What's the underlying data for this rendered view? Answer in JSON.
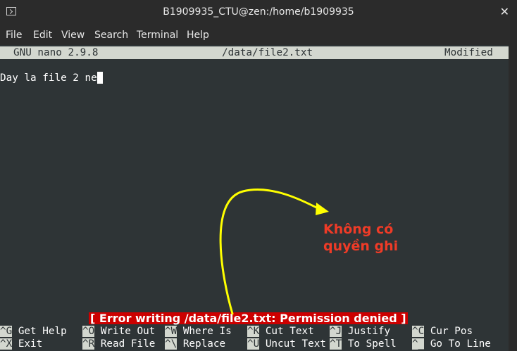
{
  "window": {
    "title": "B1909935_CTU@zen:/home/b1909935",
    "close_glyph": "✕"
  },
  "menu": [
    "File",
    "Edit",
    "View",
    "Search",
    "Terminal",
    "Help"
  ],
  "nano": {
    "version": "GNU nano 2.9.8",
    "filename": "/data/file2.txt",
    "state": "Modified",
    "content": "Day la file 2 ne",
    "status_message": "[ Error writing /data/file2.txt: Permission denied ]"
  },
  "shortcuts_row1": [
    {
      "key": "^G",
      "label": "Get Help"
    },
    {
      "key": "^O",
      "label": "Write Out"
    },
    {
      "key": "^W",
      "label": "Where Is"
    },
    {
      "key": "^K",
      "label": "Cut Text"
    },
    {
      "key": "^J",
      "label": "Justify"
    },
    {
      "key": "^C",
      "label": "Cur Pos"
    }
  ],
  "shortcuts_row2": [
    {
      "key": "^X",
      "label": "Exit"
    },
    {
      "key": "^R",
      "label": "Read File"
    },
    {
      "key": "^\\",
      "label": "Replace"
    },
    {
      "key": "^U",
      "label": "Uncut Text"
    },
    {
      "key": "^T",
      "label": "To Spell"
    },
    {
      "key": "^_",
      "label": "Go To Line"
    }
  ],
  "annotation": {
    "line1": "Không có",
    "line2": "quyền ghi"
  },
  "colors": {
    "annotation_text": "#ef3b27",
    "arrow": "#ffff00",
    "status_bg": "#cc0000",
    "terminal_bg": "#2e3436"
  }
}
